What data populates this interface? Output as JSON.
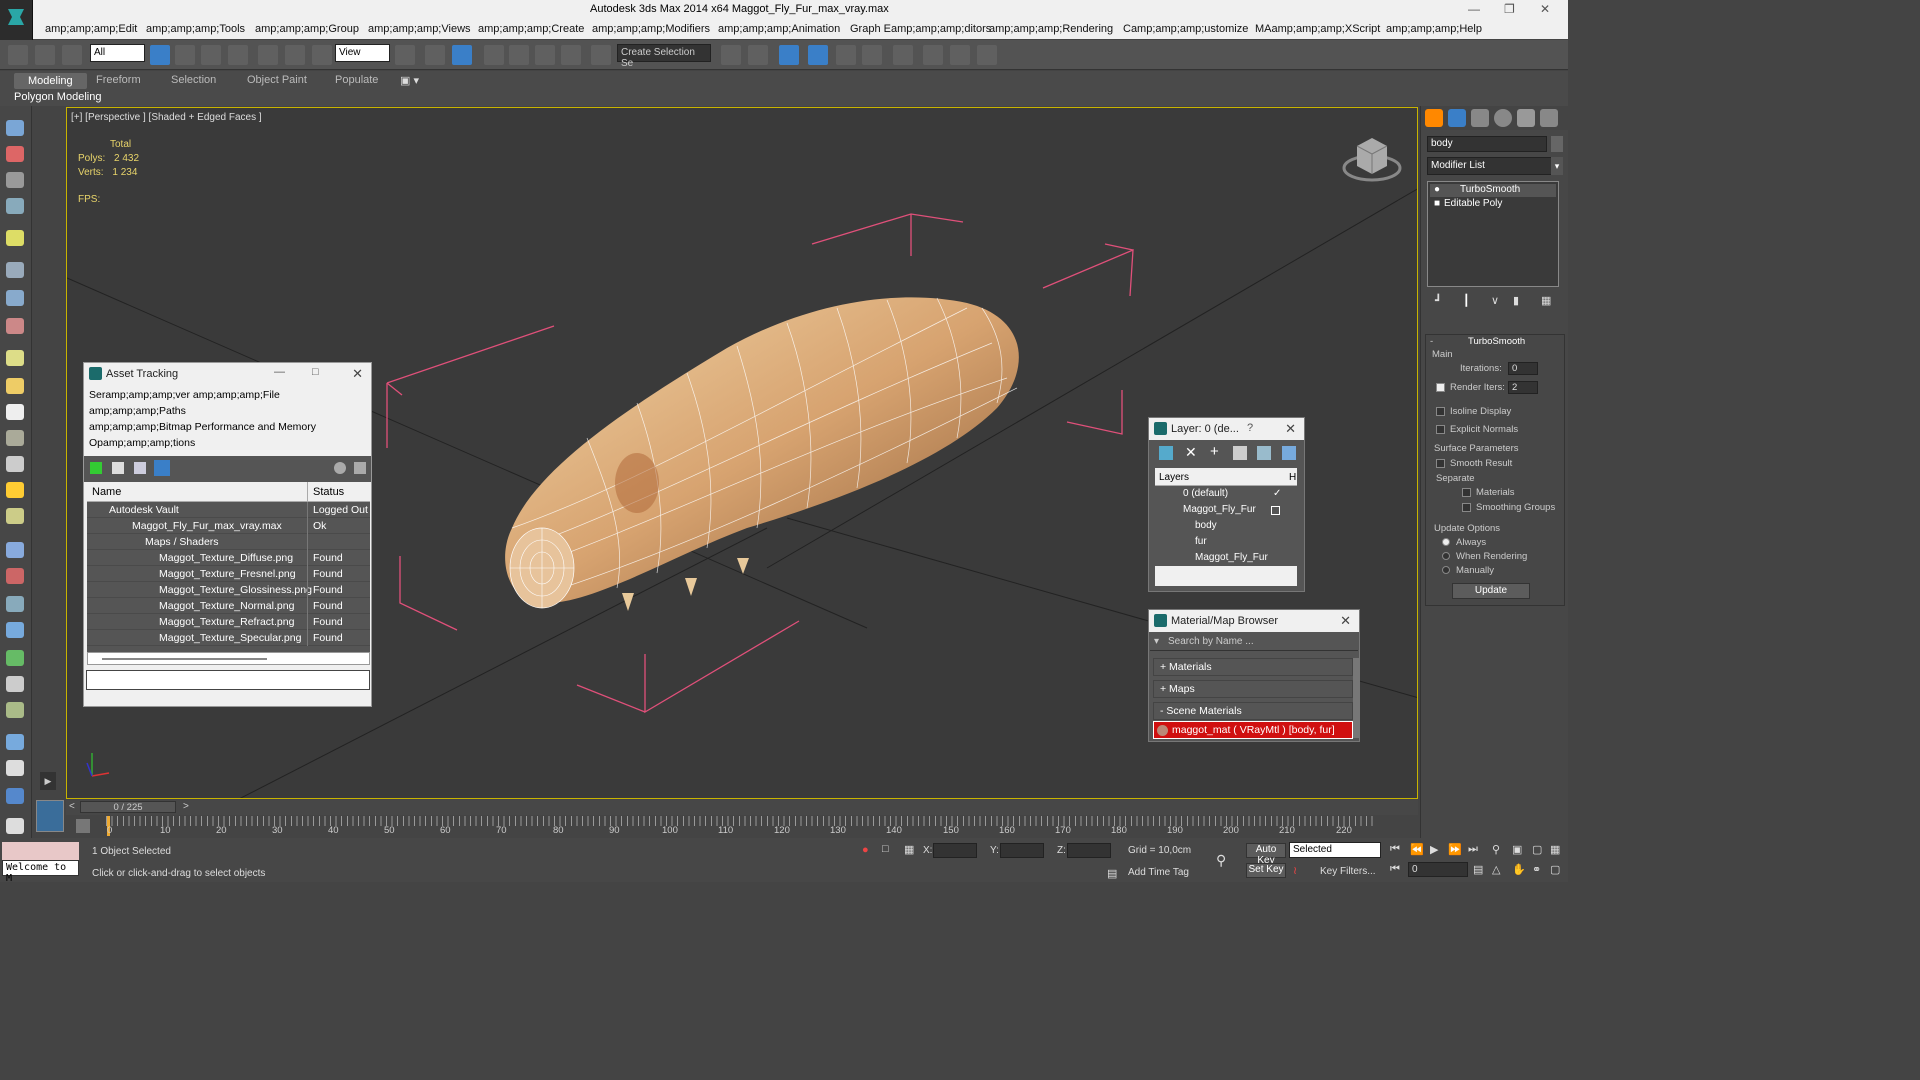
{
  "app": {
    "title": "Autodesk 3ds Max  2014 x64     Maggot_Fly_Fur_max_vray.max"
  },
  "menu": [
    "amp;amp;amp;Edit",
    "amp;amp;amp;Tools",
    "amp;amp;amp;Group",
    "amp;amp;amp;Views",
    "amp;amp;amp;Create",
    "amp;amp;amp;Modifiers",
    "amp;amp;amp;Animation",
    "Graph Eamp;amp;amp;ditors",
    "amp;amp;amp;Rendering",
    "Camp;amp;amp;ustomize",
    "MAamp;amp;amp;XScript",
    "amp;amp;amp;Help"
  ],
  "toolbar": {
    "filter": "All",
    "refcoord": "View",
    "selection_set": "Create Selection Se"
  },
  "ribbon": {
    "tabs": [
      "Modeling",
      "Freeform",
      "Selection",
      "Object Paint",
      "Populate"
    ],
    "sub": "Polygon Modeling"
  },
  "viewport": {
    "label": "[+] [Perspective ] [Shaded + Edged Faces ]",
    "stats_total": "Total",
    "polys_label": "Polys:",
    "polys_value": "2 432",
    "verts_label": "Verts:",
    "verts_value": "1 234",
    "fps_label": "FPS:"
  },
  "asset_tracking": {
    "title": "Asset Tracking",
    "menu": [
      "Seramp;amp;amp;ver     amp;amp;amp;File",
      "amp;amp;amp;Paths",
      "amp;amp;amp;Bitmap Performance and Memory",
      "Opamp;amp;amp;tions"
    ],
    "col_name": "Name",
    "col_status": "Status",
    "rows": [
      {
        "name": "Autodesk Vault",
        "status": "Logged Out ."
      },
      {
        "name": "Maggot_Fly_Fur_max_vray.max",
        "status": "Ok"
      },
      {
        "name": "Maps / Shaders",
        "status": ""
      },
      {
        "name": "Maggot_Texture_Diffuse.png",
        "status": "Found"
      },
      {
        "name": "Maggot_Texture_Fresnel.png",
        "status": "Found"
      },
      {
        "name": "Maggot_Texture_Glossiness.png",
        "status": "Found"
      },
      {
        "name": "Maggot_Texture_Normal.png",
        "status": "Found"
      },
      {
        "name": "Maggot_Texture_Refract.png",
        "status": "Found"
      },
      {
        "name": "Maggot_Texture_Specular.png",
        "status": "Found"
      }
    ]
  },
  "layer_panel": {
    "title": "Layer: 0 (de...",
    "help": "?",
    "header": "Layers",
    "header_col": "H",
    "rows": [
      "0 (default)",
      "Maggot_Fly_Fur",
      "body",
      "fur",
      "Maggot_Fly_Fur"
    ]
  },
  "mat_browser": {
    "title": "Material/Map Browser",
    "search_placeholder": "Search by Name ...",
    "materials": "+ Materials",
    "maps": "+ Maps",
    "scene": "- Scene Materials",
    "scene_item": "maggot_mat  ( VRayMtl ) [body, fur]"
  },
  "command_panel": {
    "object_name": "body",
    "modifier_list": "Modifier List",
    "stack": [
      "TurboSmooth",
      "Editable Poly"
    ],
    "rollout_title": "TurboSmooth",
    "main": "Main",
    "iterations_label": "Iterations:",
    "iterations_value": "0",
    "render_iters_label": "Render Iters:",
    "render_iters_value": "2",
    "isoline": "Isoline Display",
    "explicit_normals": "Explicit Normals",
    "surface_params": "Surface Parameters",
    "smooth_result": "Smooth Result",
    "separate": "Separate",
    "materials": "Materials",
    "smoothing_groups": "Smoothing Groups",
    "update_options": "Update Options",
    "always": "Always",
    "when_rendering": "When Rendering",
    "manually": "Manually",
    "update_btn": "Update"
  },
  "timeline": {
    "frame": "0 / 225",
    "ticks": [
      "0",
      "10",
      "20",
      "30",
      "40",
      "50",
      "60",
      "70",
      "80",
      "90",
      "100",
      "110",
      "120",
      "130",
      "140",
      "150",
      "160",
      "170",
      "180",
      "190",
      "200",
      "210",
      "220"
    ]
  },
  "status": {
    "welcome": "Welcome to M",
    "selected": "1 Object Selected",
    "prompt": "Click or click-and-drag to select objects",
    "x": "X:",
    "y": "Y:",
    "z": "Z:",
    "grid": "Grid = 10,0cm",
    "add_time_tag": "Add Time Tag",
    "auto_key": "Auto Key",
    "set_key": "Set Key",
    "selected_dd": "Selected",
    "key_filters": "Key Filters...",
    "frame_field": "0"
  },
  "colors": {
    "accent_teal": "#1b6b6b",
    "viewport_border": "#c8b400",
    "stats_yellow": "#e8d46a",
    "bbox_pink": "#e0507a",
    "selection_red": "#d01010"
  }
}
